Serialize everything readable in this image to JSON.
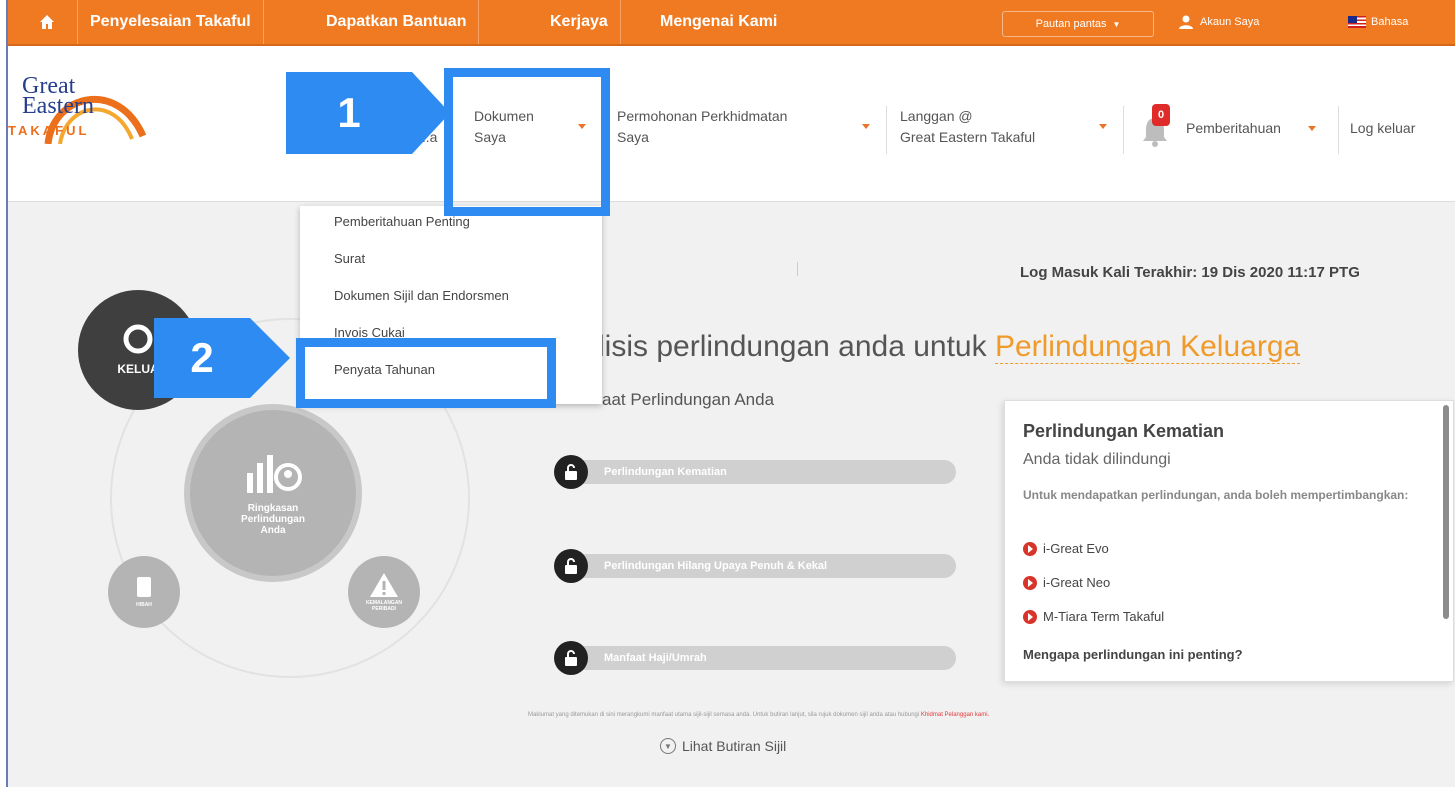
{
  "topbar": {
    "nav": [
      "Penyelesaian Takaful",
      "Dapatkan Bantuan",
      "Kerjaya",
      "Mengenai Kami"
    ],
    "quick_links": "Pautan pantas",
    "account": "Akaun Saya",
    "language": "Bahasa"
  },
  "logo": {
    "line1": "Great",
    "line2": "Eastern",
    "line3": "TAKAFUL"
  },
  "mainnav": {
    "item1_l1": "...o",
    "item1_l2": "...a",
    "dokumen_l1": "Dokumen",
    "dokumen_l2": "Saya",
    "permohonan_l1": "Permohonan Perkhidmatan",
    "permohonan_l2": "Saya",
    "langgan_l1": "Langgan @",
    "langgan_l2": "Great Eastern Takaful",
    "notif_count": "0",
    "notif_label": "Pemberitahuan",
    "logout": "Log keluar"
  },
  "dropdown": {
    "items": [
      "Pemberitahuan Penting",
      "Surat",
      "Dokumen Sijil dan Endorsmen",
      "Invois Cukai",
      "Penyata Tahunan"
    ]
  },
  "callouts": {
    "step1": "1",
    "step2": "2"
  },
  "login_info": "Log Masuk Kali Terakhir: 19 Dis 2020 11:17 PTG",
  "analysis": {
    "prefix": "lisis perlindungan anda untuk ",
    "highlight": "Perlindungan Keluarga"
  },
  "subhead": "aat Perlindungan Anda",
  "protection_bars": [
    "Perlindungan Kematian",
    "Perlindungan Hilang Upaya Penuh & Kekal",
    "Manfaat Haji/Umrah"
  ],
  "left_graphic": {
    "family": "KELUA",
    "summary_l1": "Ringkasan",
    "summary_l2": "Perlindungan",
    "summary_l3": "Anda",
    "small1": "HIBAH",
    "small2_l1": "KEMALANGAN",
    "small2_l2": "PERIBADI"
  },
  "card": {
    "title": "Perlindungan Kematian",
    "status": "Anda tidak dilindungi",
    "desc": "Untuk mendapatkan perlindungan, anda boleh mempertimbangkan:",
    "products": [
      "i-Great Evo",
      "i-Great Neo",
      "M-Tiara Term Takaful"
    ],
    "why": "Mengapa perlindungan ini penting?"
  },
  "disclaimer": {
    "text": "Maklumat yang ditemukan di sini merangkumi manfaat utama sijil-sijil semasa anda. Untuk butiran lanjut, sila rujuk dokumen sijil anda atau hubungi ",
    "link": "Khidmat Pelanggan kami."
  },
  "details_link": "Lihat Butiran Sijil",
  "colors": {
    "brand_orange": "#f07a21",
    "annotation_blue": "#2e8bf2",
    "alert_red": "#d8342a"
  }
}
